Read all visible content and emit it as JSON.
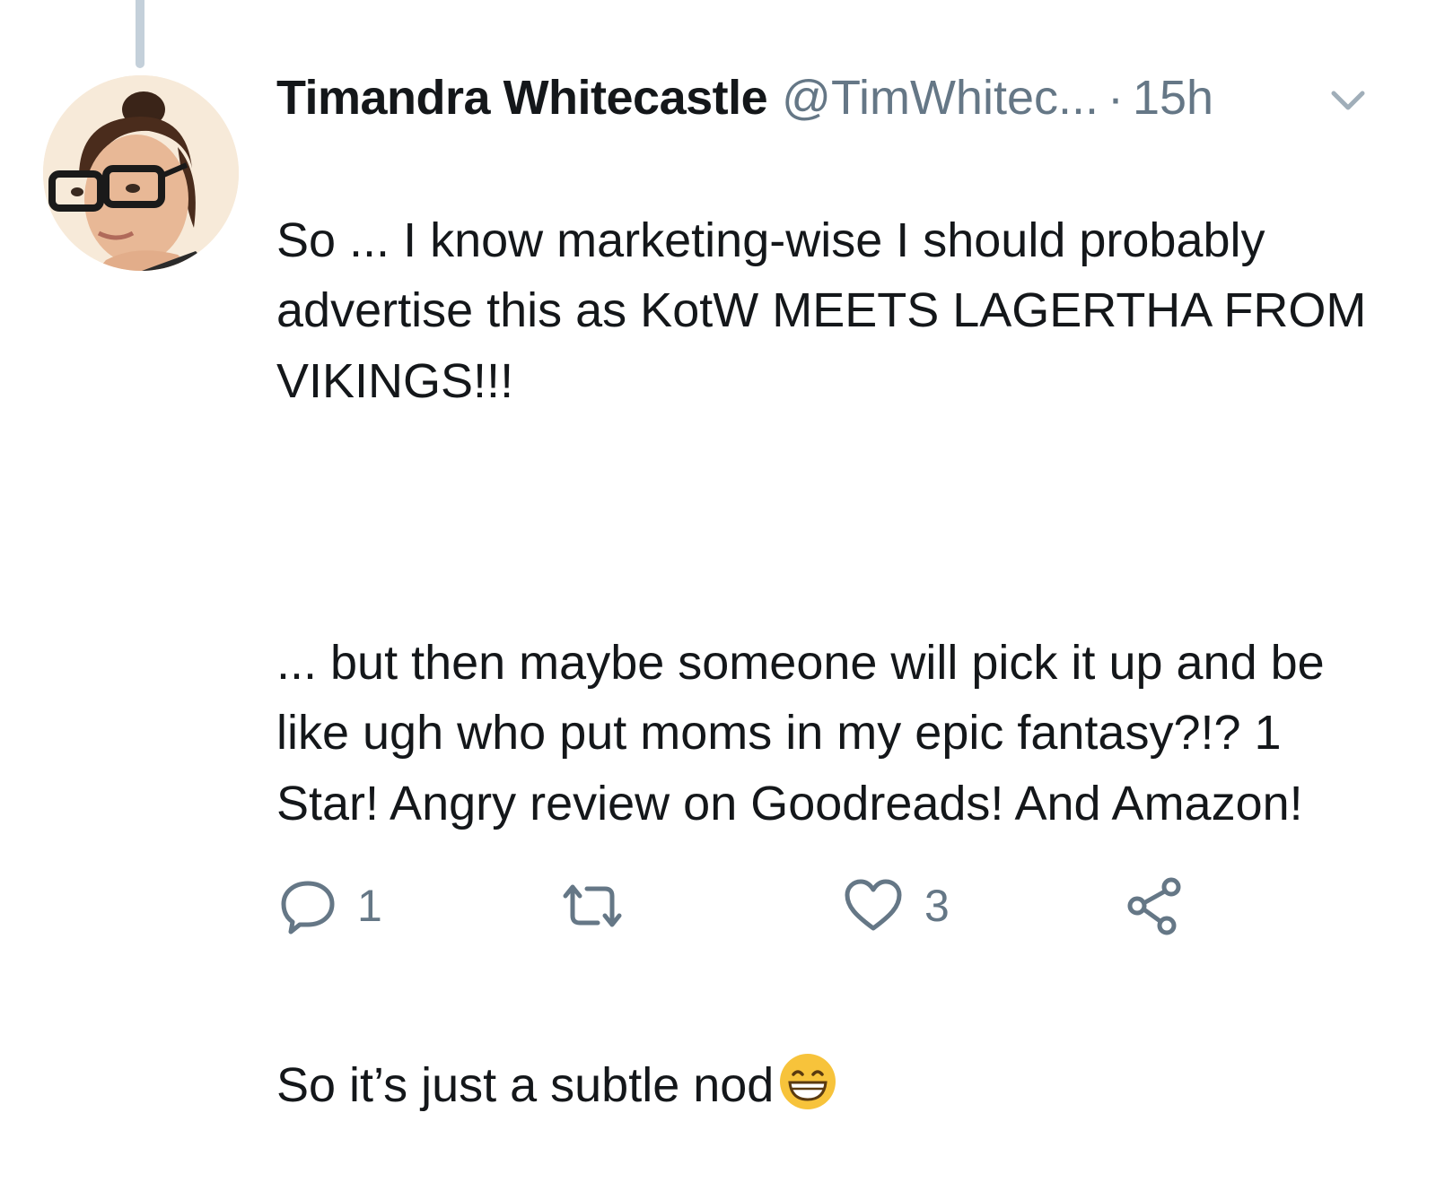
{
  "tweet": {
    "display_name": "Timandra Whitecastle",
    "handle": "@TimWhitec...",
    "separator": "·",
    "time": "15h",
    "paragraphs": [
      "So ... I know marketing-wise I should probably advertise this as KotW MEETS LAGERTHA FROM VIKINGS!!!",
      "... but then maybe someone will pick it up and be like ugh who put moms in my epic fantasy?!? 1 Star! Angry review on Goodreads! And Amazon!",
      "So it’s just a subtle nod"
    ],
    "emoji": "grinning-face-emoji"
  },
  "actions": {
    "reply_count": "1",
    "retweet_count": "",
    "like_count": "3"
  },
  "colors": {
    "text": "#14171a",
    "secondary": "#657786",
    "thread_line": "#c4d0da",
    "emoji": "#f7c33b"
  }
}
